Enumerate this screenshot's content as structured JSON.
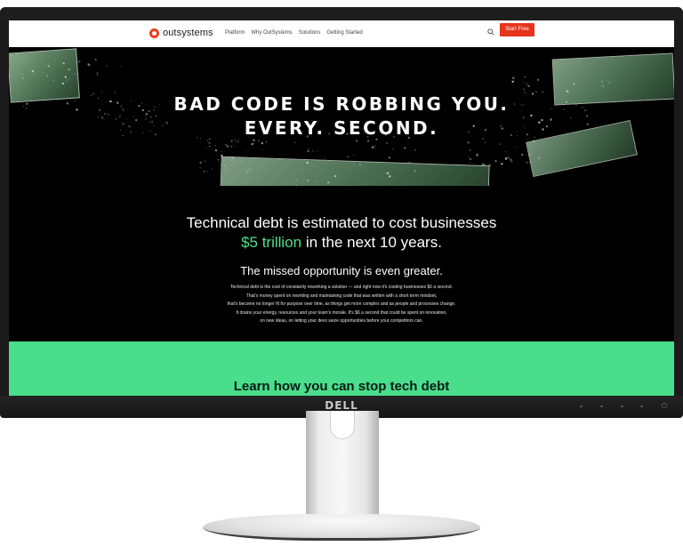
{
  "monitor": {
    "brand": "DELL"
  },
  "nav": {
    "logo_text": "outsystems",
    "links": [
      "Platform",
      "Why OutSystems",
      "Solutions",
      "Getting Started"
    ],
    "cta_label": "Start Free"
  },
  "hero": {
    "line1": "BAD CODE IS ROBBING YOU.",
    "line2": "EVERY. SECOND."
  },
  "debt": {
    "headline_part1": "Technical debt is estimated to cost businesses",
    "headline_highlight": "$5 trillion",
    "headline_part2": " in the next 10 years.",
    "subheadline": "The missed opportunity is even greater.",
    "paragraph_lines": [
      "Technical debt is the cost of constantly reworking a solution — and right now it's costing businesses $6 a second.",
      "That's money spent on rewriting and maintaining code that was written with a short term mindset,",
      "that's become no longer fit for purpose over time, as things get more complex and as people and processes change.",
      "It drains your energy, resources and your team's morale. It's $6 a second that could be spent on innovation,",
      "on new ideas, on letting your devs seize opportunities before your competitors can."
    ]
  },
  "cta_section": {
    "title": "Learn how you can stop tech debt"
  },
  "colors": {
    "accent": "#e5351b",
    "highlight": "#4ee08b",
    "cta_bg": "#49dd8c"
  }
}
